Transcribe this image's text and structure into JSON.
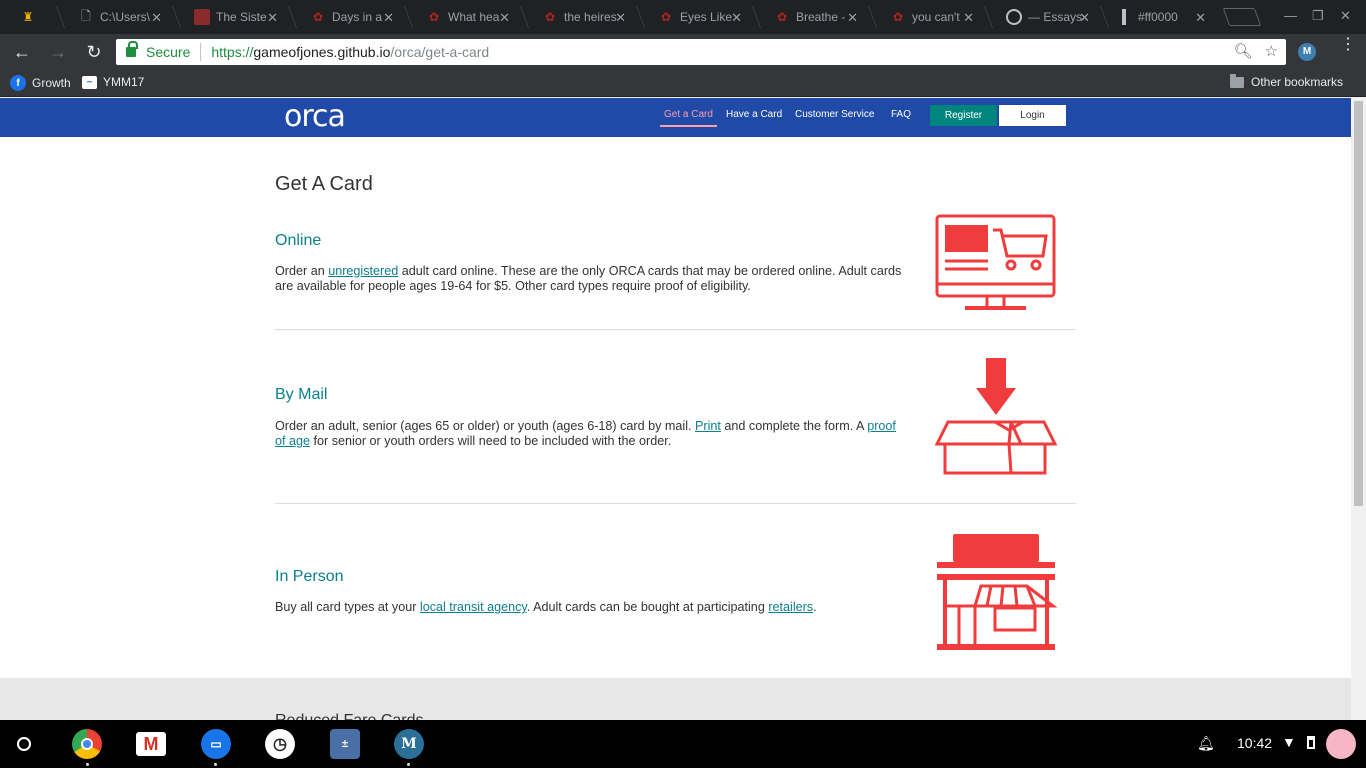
{
  "browser": {
    "tabs": [
      {
        "title": "",
        "icon": "castle-icon"
      },
      {
        "title": "C:\\Users\\",
        "icon": "file-icon"
      },
      {
        "title": "The Siste",
        "icon": "picture-icon"
      },
      {
        "title": "Days in a",
        "icon": "ao3-icon"
      },
      {
        "title": "What hea",
        "icon": "ao3-icon"
      },
      {
        "title": "the heires",
        "icon": "ao3-icon"
      },
      {
        "title": "Eyes Like",
        "icon": "ao3-icon"
      },
      {
        "title": "Breathe -",
        "icon": "ao3-icon"
      },
      {
        "title": "you can't",
        "icon": "ao3-icon"
      },
      {
        "title": "— Essays",
        "icon": "circle-logo-icon"
      },
      {
        "title": "#ff0000",
        "icon": "color-icon"
      }
    ],
    "secure_label": "Secure",
    "url": {
      "scheme": "https://",
      "host": "gameofjones.github.io",
      "path": "/orca/get-a-card"
    },
    "extension_letter": "M",
    "bookmarks": [
      {
        "label": "Growth",
        "icon": "f-icon"
      },
      {
        "label": "YMM17",
        "icon": "chart-icon"
      }
    ],
    "other_bookmarks": "Other bookmarks"
  },
  "site": {
    "logo": "orca",
    "nav": [
      "Get a Card",
      "Have a Card",
      "Customer Service",
      "FAQ"
    ],
    "register": "Register",
    "login": "Login",
    "accent_color": "#0b7f8e",
    "brand_color": "#1f4aa8",
    "icon_color": "#f03c3c"
  },
  "page": {
    "title": "Get A Card",
    "online": {
      "heading": "Online",
      "p1": "Order an ",
      "link1": "unregistered",
      "p2": " adult card online. These are the only ORCA cards that may be ordered online. Adult cards are available for people ages 19-64 for $5. Other card types require proof of eligibility."
    },
    "mail": {
      "heading": "By Mail",
      "p1": "Order an adult, senior (ages 65 or older) or youth (ages 6-18) card by mail. ",
      "link1": "Print",
      "p2": " and complete the form. A ",
      "link2": "proof of age",
      "p3": " for senior or youth orders will need to be included with the order."
    },
    "person": {
      "heading": "In Person",
      "p1": "Buy all card types at your ",
      "link1": "local transit agency",
      "p2": ". Adult cards can be bought at participating ",
      "link2": "retailers",
      "p3": "."
    },
    "next_section_title": "Reduced Fare Cards"
  },
  "shelf": {
    "apps": [
      "chrome-icon",
      "gmail-icon",
      "files-icon",
      "clock-icon",
      "calculator-icon",
      "m-app-icon"
    ],
    "time": "10:42"
  }
}
